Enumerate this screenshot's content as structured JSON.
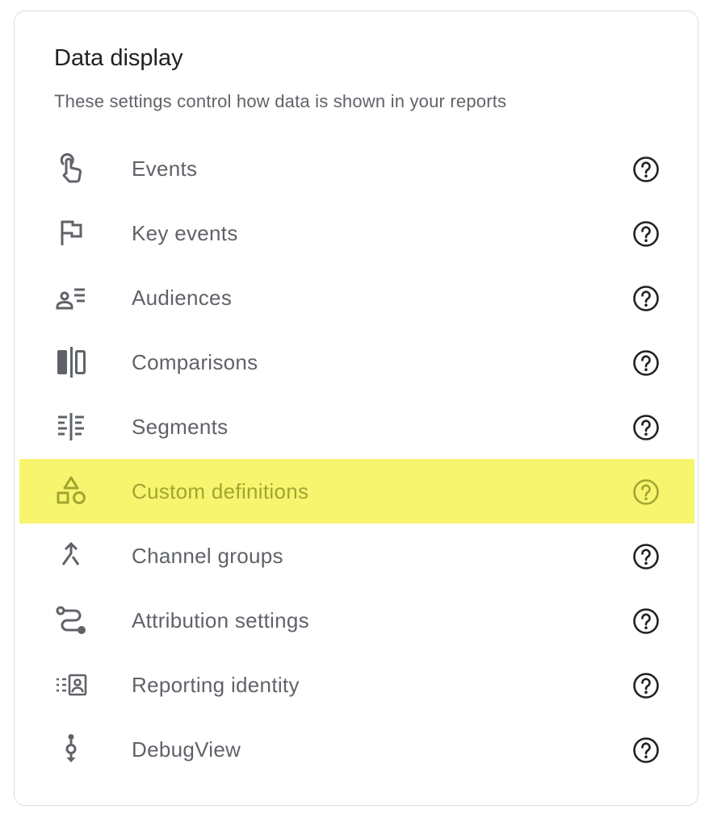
{
  "panel": {
    "title": "Data display",
    "subtitle": "These settings control how data is shown in your reports"
  },
  "items": [
    {
      "label": "Events",
      "icon": "touch-app-icon",
      "highlighted": false
    },
    {
      "label": "Key events",
      "icon": "flag-icon",
      "highlighted": false
    },
    {
      "label": "Audiences",
      "icon": "audience-list-icon",
      "highlighted": false
    },
    {
      "label": "Comparisons",
      "icon": "compare-icon",
      "highlighted": false
    },
    {
      "label": "Segments",
      "icon": "segments-icon",
      "highlighted": false
    },
    {
      "label": "Custom definitions",
      "icon": "shapes-icon",
      "highlighted": true
    },
    {
      "label": "Channel groups",
      "icon": "merge-icon",
      "highlighted": false
    },
    {
      "label": "Attribution settings",
      "icon": "route-icon",
      "highlighted": false
    },
    {
      "label": "Reporting identity",
      "icon": "identity-card-icon",
      "highlighted": false
    },
    {
      "label": "DebugView",
      "icon": "debug-step-icon",
      "highlighted": false
    }
  ],
  "colors": {
    "text": "#5f6368",
    "title": "#202124",
    "highlight": "#f7f46e",
    "highlight_text": "#a1a532",
    "border": "#dadce0"
  }
}
